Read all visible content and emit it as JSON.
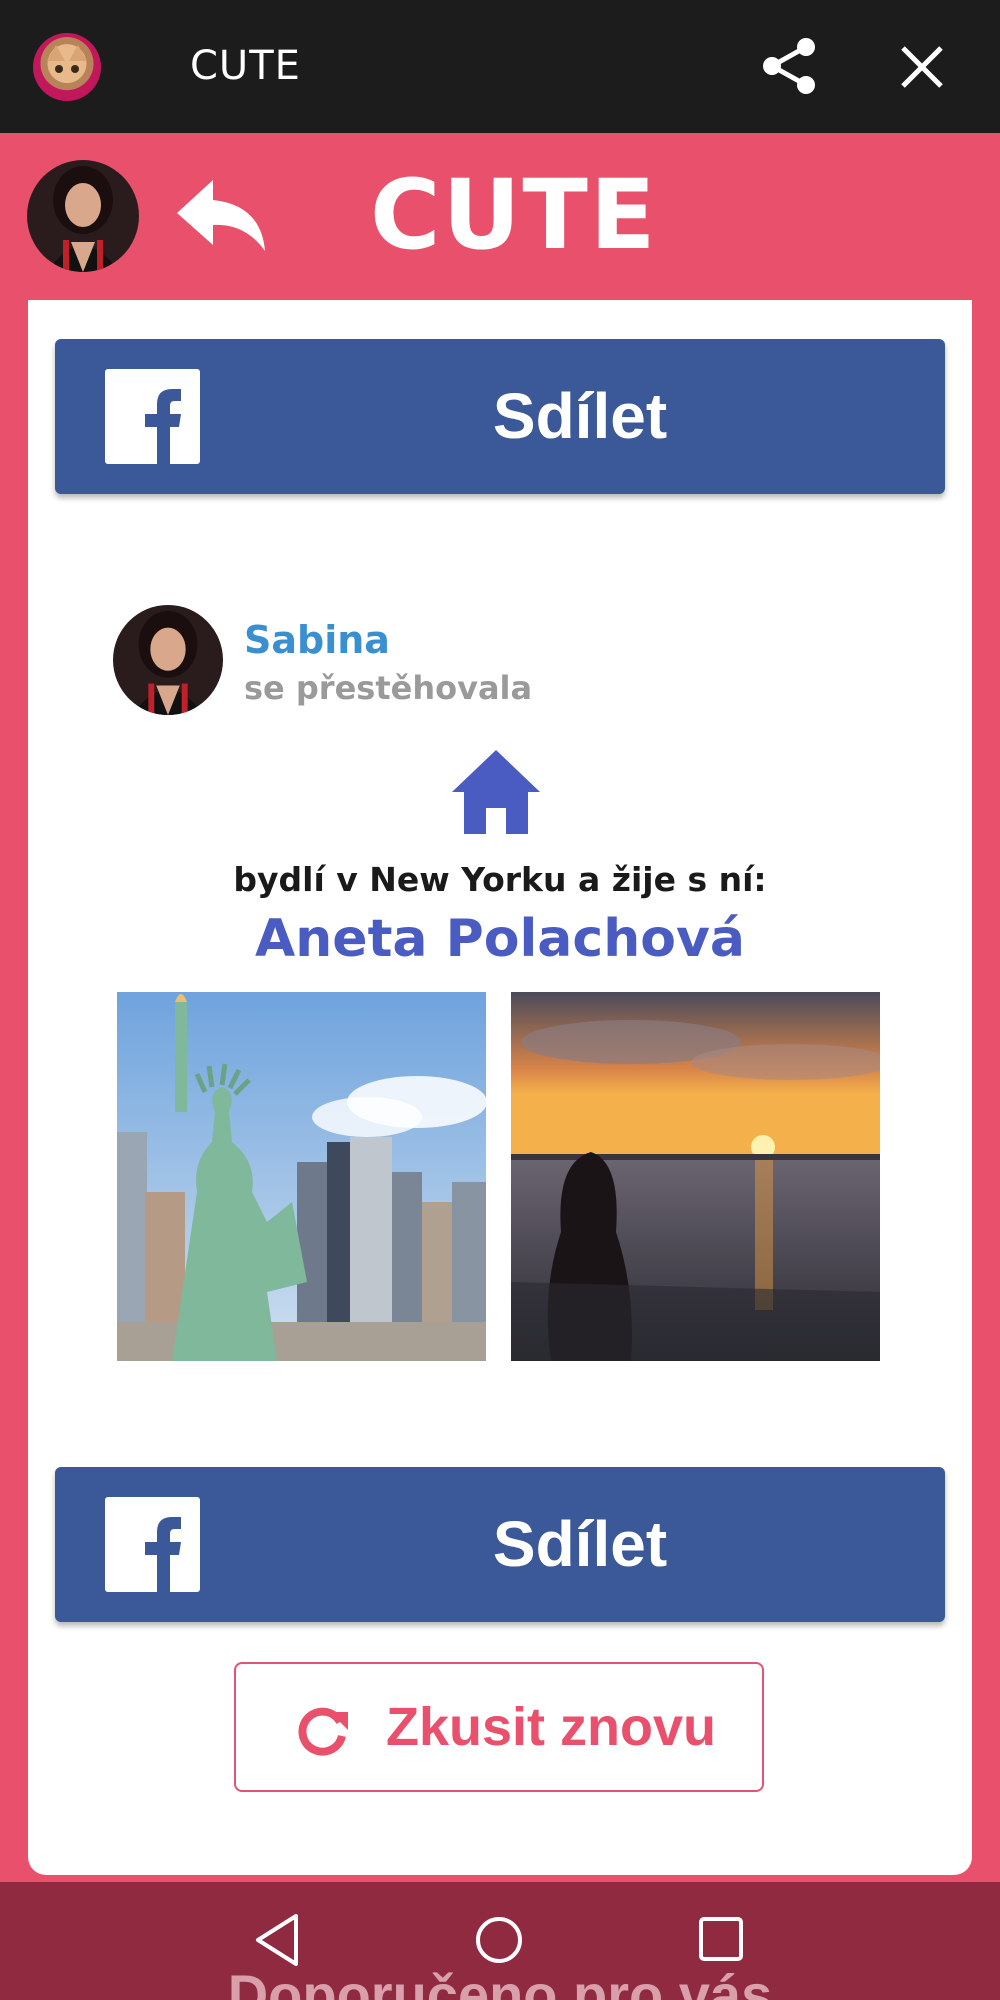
{
  "app_bar": {
    "title": "CUTE",
    "logo_icon": "cat-face-icon",
    "share_icon": "share-icon",
    "close_icon": "close-icon"
  },
  "header": {
    "title": "CUTE",
    "back_icon": "reply-arrow-icon"
  },
  "share_top": {
    "label": "Sdílet",
    "icon": "facebook-icon"
  },
  "post": {
    "name": "Sabina",
    "action": "se přestěhovala",
    "place_icon": "home-icon",
    "lives_text": "bydlí v New Yorku a žije s ní:",
    "partner": "Aneta Polachová"
  },
  "share_bottom": {
    "label": "Sdílet",
    "icon": "facebook-icon"
  },
  "retry": {
    "label": "Zkusit znovu",
    "icon": "refresh-icon"
  },
  "footer": {
    "recommended": "Doporučeno pro vás"
  },
  "colors": {
    "brand_pink": "#e9506b",
    "facebook_blue": "#3b5998",
    "name_blue": "#3a8fd1",
    "partner_blue": "#4a5cc2",
    "app_bar": "#1c1c1c"
  }
}
